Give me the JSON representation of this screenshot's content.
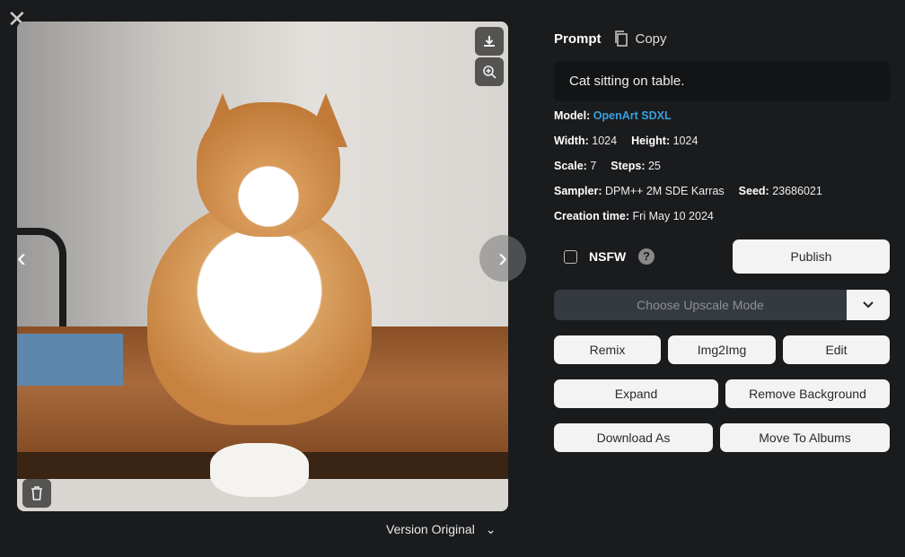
{
  "viewer": {
    "version_label": "Version Original",
    "image_alt": "Cat sitting on table."
  },
  "prompt": {
    "heading": "Prompt",
    "copy_label": "Copy",
    "text": "Cat sitting on table."
  },
  "meta": {
    "model_label": "Model:",
    "model": "OpenArt SDXL",
    "width_label": "Width:",
    "width": "1024",
    "height_label": "Height:",
    "height": "1024",
    "scale_label": "Scale:",
    "scale": "7",
    "steps_label": "Steps:",
    "steps": "25",
    "sampler_label": "Sampler:",
    "sampler": "DPM++ 2M SDE Karras",
    "seed_label": "Seed:",
    "seed": "23686021",
    "creation_label": "Creation time:",
    "creation": "Fri May 10 2024"
  },
  "nsfw": {
    "label": "NSFW",
    "checked": false,
    "help": "?"
  },
  "buttons": {
    "publish": "Publish",
    "upscale_placeholder": "Choose Upscale Mode",
    "remix": "Remix",
    "img2img": "Img2Img",
    "edit": "Edit",
    "expand": "Expand",
    "remove_bg": "Remove Background",
    "download_as": "Download As",
    "move_albums": "Move To Albums"
  },
  "colors": {
    "accent_link": "#3aa0e0",
    "background": "#1a1b1d"
  }
}
